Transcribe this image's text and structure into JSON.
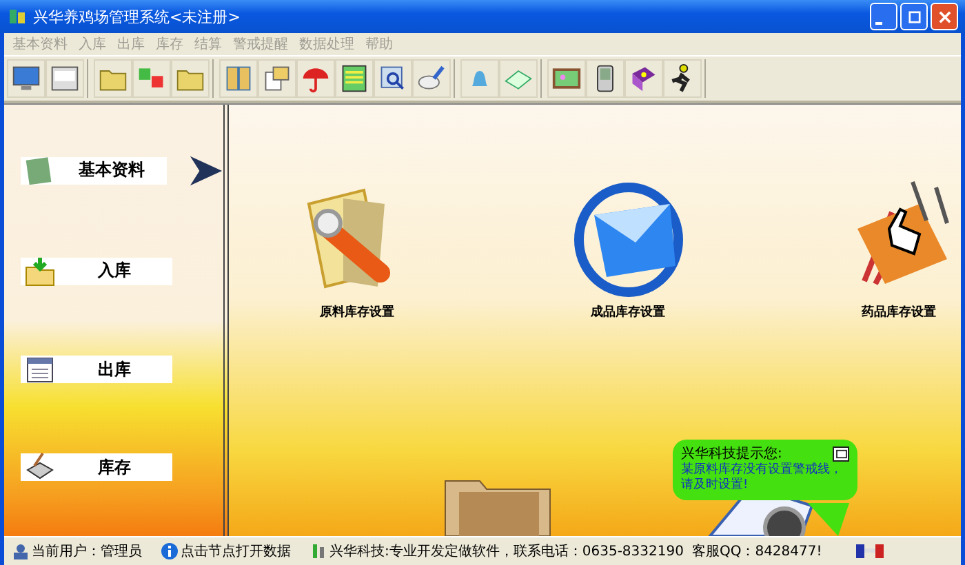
{
  "window": {
    "title": "兴华养鸡场管理系统<未注册>"
  },
  "menu": [
    {
      "label": "基本资料",
      "disabled": true
    },
    {
      "label": "入库",
      "disabled": true
    },
    {
      "label": "出库",
      "disabled": true
    },
    {
      "label": "库存",
      "disabled": true
    },
    {
      "label": "结算",
      "disabled": true
    },
    {
      "label": "警戒提醒",
      "disabled": true
    },
    {
      "label": "数据处理",
      "disabled": true
    },
    {
      "label": "帮助",
      "disabled": true
    }
  ],
  "sidebar": {
    "items": [
      {
        "kind": "notes",
        "label": "基本资料",
        "selected": true
      },
      {
        "kind": "import",
        "label": "入库",
        "selected": false
      },
      {
        "kind": "calendar",
        "label": "出库",
        "selected": false
      },
      {
        "kind": "printer",
        "label": "库存",
        "selected": false
      }
    ]
  },
  "features": [
    {
      "kind": "tool",
      "label": "原料库存设置"
    },
    {
      "kind": "mail",
      "label": "成品库存设置"
    },
    {
      "kind": "hand",
      "label": "药品库存设置"
    }
  ],
  "notification": {
    "title": "兴华科技提示您:",
    "message": "某原料库存没有设置警戒线，请及时设置!"
  },
  "status_bar": {
    "user": "当前用户：管理员",
    "hint": "点击节点打开数据",
    "company": "兴华科技:专业开发定做软件，联系电话：0635-8332190",
    "qq": "客服QQ：8428477!"
  }
}
